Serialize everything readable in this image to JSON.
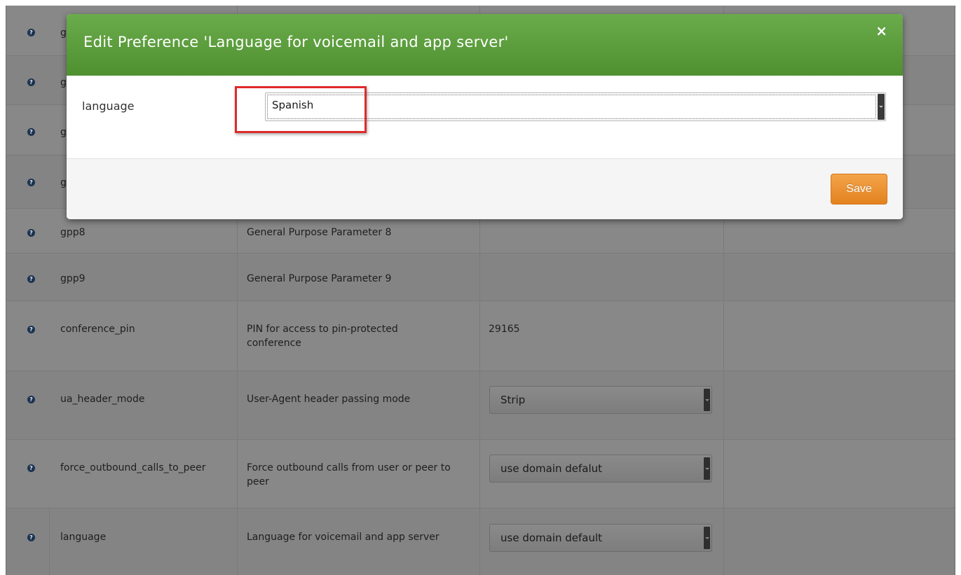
{
  "modal": {
    "title": "Edit Preference 'Language for voicemail and app server'",
    "close_label": "×",
    "field_label": "language",
    "selected_value": "Spanish",
    "save_label": "Save",
    "header_color": "#5c9e3d",
    "save_color": "#e8902f",
    "highlight_color": "#e02b2b"
  },
  "table": {
    "help_glyph": "?",
    "rows": [
      {
        "name": "g",
        "description": "",
        "value": "",
        "control": "text"
      },
      {
        "name": "g",
        "description": "",
        "value": "",
        "control": "text"
      },
      {
        "name": "g",
        "description": "",
        "value": "",
        "control": "text"
      },
      {
        "name": "g",
        "description": "",
        "value": "",
        "control": "text"
      },
      {
        "name": "gpp8",
        "description": "General Purpose Parameter 8",
        "value": "",
        "control": "text"
      },
      {
        "name": "gpp9",
        "description": "General Purpose Parameter 9",
        "value": "",
        "control": "text"
      },
      {
        "name": "conference_pin",
        "description": "PIN for access to pin-protected conference",
        "value": "29165",
        "control": "text"
      },
      {
        "name": "ua_header_mode",
        "description": "User-Agent header passing mode",
        "value": "Strip",
        "control": "select"
      },
      {
        "name": "force_outbound_calls_to_peer",
        "description": "Force outbound calls from user or peer to peer",
        "value": "use domain defalut",
        "control": "select"
      },
      {
        "name": "language",
        "description": "Language for voicemail and app server",
        "value": "use domain default",
        "control": "select"
      }
    ]
  }
}
